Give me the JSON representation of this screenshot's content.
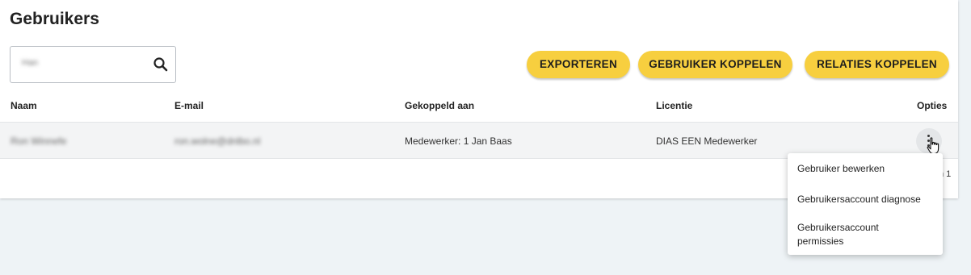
{
  "page": {
    "title": "Gebruikers"
  },
  "search": {
    "value": "Han"
  },
  "actions": {
    "export_label": "EXPORTEREN",
    "link_user_label": "GEBRUIKER KOPPELEN",
    "link_relations_label": "RELATIES KOPPELEN"
  },
  "table": {
    "columns": [
      "Naam",
      "E-mail",
      "Gekoppeld aan",
      "Licentie",
      "Opties"
    ],
    "rows": [
      {
        "naam": "Ron Winnefe",
        "email": "ron.wolne@dnlbo.nl",
        "gekoppeld": "Medewerker: 1 Jan Baas",
        "licentie": "DIAS EEN Medewerker"
      }
    ]
  },
  "pagination": {
    "text": "n 1"
  },
  "options_menu": {
    "items": [
      "Gebruiker bewerken",
      "Gebruikersaccount diagnose",
      "Gebruikersaccount permissies"
    ]
  },
  "colors": {
    "accent": "#f7cf3f",
    "background": "#eef3f6"
  },
  "icons": {
    "search": "search-icon",
    "more": "more-vertical-icon",
    "cursor": "hand-pointer-icon"
  }
}
